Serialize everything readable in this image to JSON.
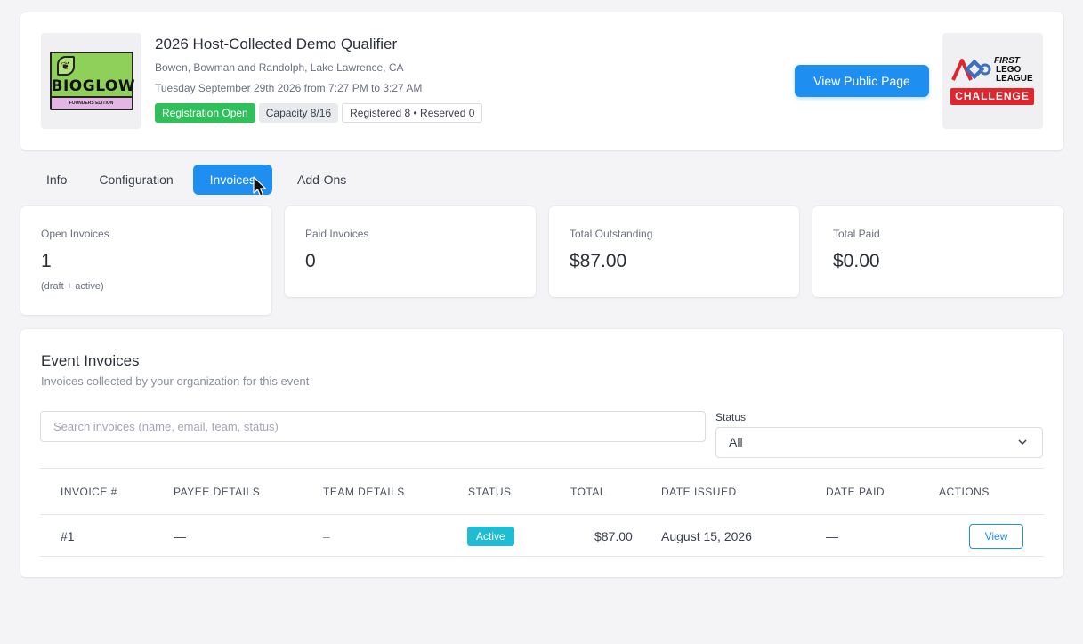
{
  "event": {
    "logo_text": "BIOGLOW",
    "logo_subtext": "FOUNDERS EDITION",
    "title": "2026 Host-Collected Demo Qualifier",
    "location": "Bowen, Bowman and Randolph, Lake Lawrence, CA",
    "date": "Tuesday September 29th 2026 from 7:27 PM to 3:27 AM",
    "badges": {
      "registration": "Registration Open",
      "capacity": "Capacity 8/16",
      "registered": "Registered 8 • Reserved 0"
    },
    "view_public_label": "View Public Page",
    "program_logo": {
      "first": "FIRST",
      "lego": "LEGO",
      "league": "LEAGUE",
      "challenge": "CHALLENGE"
    }
  },
  "tabs": [
    "Info",
    "Configuration",
    "Invoices",
    "Add-Ons"
  ],
  "active_tab": "Invoices",
  "stats": [
    {
      "label": "Open Invoices",
      "value": "1",
      "sub": "(draft + active)"
    },
    {
      "label": "Paid Invoices",
      "value": "0"
    },
    {
      "label": "Total Outstanding",
      "value": "$87.00"
    },
    {
      "label": "Total Paid",
      "value": "$0.00"
    }
  ],
  "invoices": {
    "title": "Event Invoices",
    "subtitle": "Invoices collected by your organization for this event",
    "search_placeholder": "Search invoices (name, email, team, status)",
    "search_value": "",
    "status_label": "Status",
    "status_value": "All",
    "columns": [
      "INVOICE #",
      "PAYEE DETAILS",
      "TEAM DETAILS",
      "STATUS",
      "TOTAL",
      "DATE ISSUED",
      "DATE PAID",
      "ACTIONS"
    ],
    "rows": [
      {
        "invoice": "#1",
        "payee": "—",
        "team": "–",
        "status": "Active",
        "total": "$87.00",
        "date_issued": "August 15, 2026",
        "date_paid": "—",
        "action": "View"
      }
    ]
  },
  "colors": {
    "primary": "#1e8ef0",
    "success": "#2fc05c",
    "info": "#1fbcd2",
    "danger": "#e1252d"
  }
}
